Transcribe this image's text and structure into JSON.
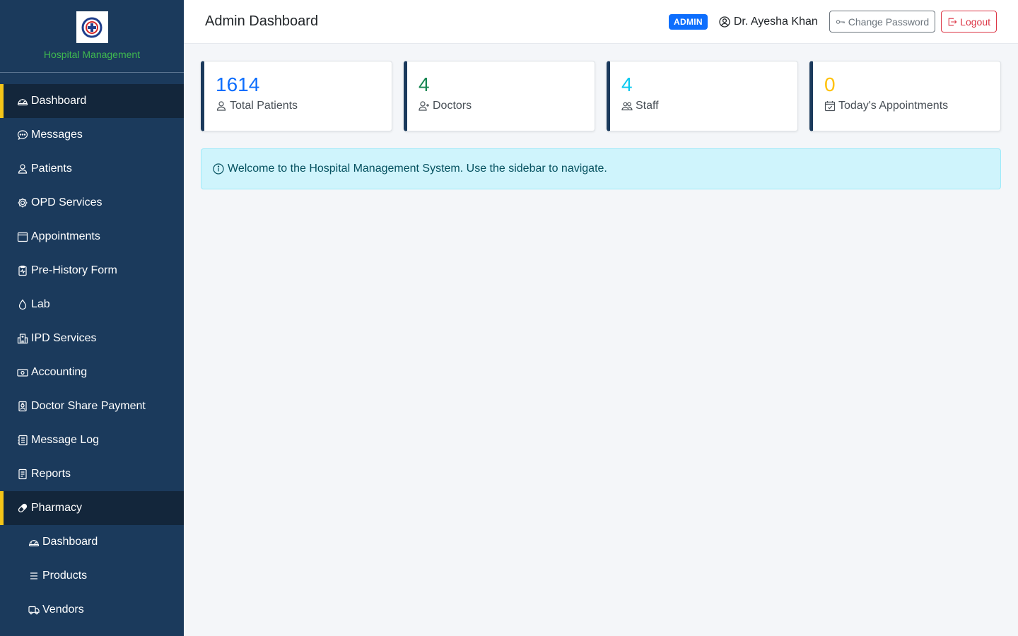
{
  "brand": {
    "name": "Hospital Management",
    "logo_icon": "hospital-logo-icon"
  },
  "sidebar": {
    "items": [
      {
        "label": "Dashboard",
        "icon": "speedometer-icon",
        "active": true
      },
      {
        "label": "Messages",
        "icon": "chat-icon",
        "active": false
      },
      {
        "label": "Patients",
        "icon": "person-icon",
        "active": false
      },
      {
        "label": "OPD Services",
        "icon": "gear-icon",
        "active": false
      },
      {
        "label": "Appointments",
        "icon": "calendar-icon",
        "active": false
      },
      {
        "label": "Pre-History Form",
        "icon": "clipboard-pulse-icon",
        "active": false
      },
      {
        "label": "Lab",
        "icon": "droplet-icon",
        "active": false
      },
      {
        "label": "IPD Services",
        "icon": "hospital-icon",
        "active": false
      },
      {
        "label": "Accounting",
        "icon": "cash-icon",
        "active": false
      },
      {
        "label": "Doctor Share Payment",
        "icon": "person-badge-icon",
        "active": false
      },
      {
        "label": "Message Log",
        "icon": "journal-icon",
        "active": false
      },
      {
        "label": "Reports",
        "icon": "file-text-icon",
        "active": false
      },
      {
        "label": "Pharmacy",
        "icon": "capsule-icon",
        "active": true
      }
    ],
    "pharmacy_sub": [
      {
        "label": "Dashboard",
        "icon": "speedometer-icon"
      },
      {
        "label": "Products",
        "icon": "list-icon"
      },
      {
        "label": "Vendors",
        "icon": "truck-icon"
      }
    ]
  },
  "header": {
    "title": "Admin Dashboard",
    "role_badge": "ADMIN",
    "user_name": "Dr. Ayesha Khan",
    "change_password_label": "Change Password",
    "logout_label": "Logout"
  },
  "stats": [
    {
      "value": "1614",
      "label": "Total Patients",
      "color": "#0d6efd",
      "icon": "person-icon"
    },
    {
      "value": "4",
      "label": "Doctors",
      "color": "#198754",
      "icon": "person-plus-icon"
    },
    {
      "value": "4",
      "label": "Staff",
      "color": "#0dcaf0",
      "icon": "people-icon"
    },
    {
      "value": "0",
      "label": "Today's Appointments",
      "color": "#ffc107",
      "icon": "calendar-check-icon"
    }
  ],
  "alert": {
    "text": "Welcome to the Hospital Management System. Use the sidebar to navigate.",
    "icon": "info-circle-icon"
  },
  "colors": {
    "sidebar_bg": "#1b3a5c",
    "active_bg": "#13263b",
    "active_accent": "#f5c518",
    "brand_text": "#3fb950"
  }
}
